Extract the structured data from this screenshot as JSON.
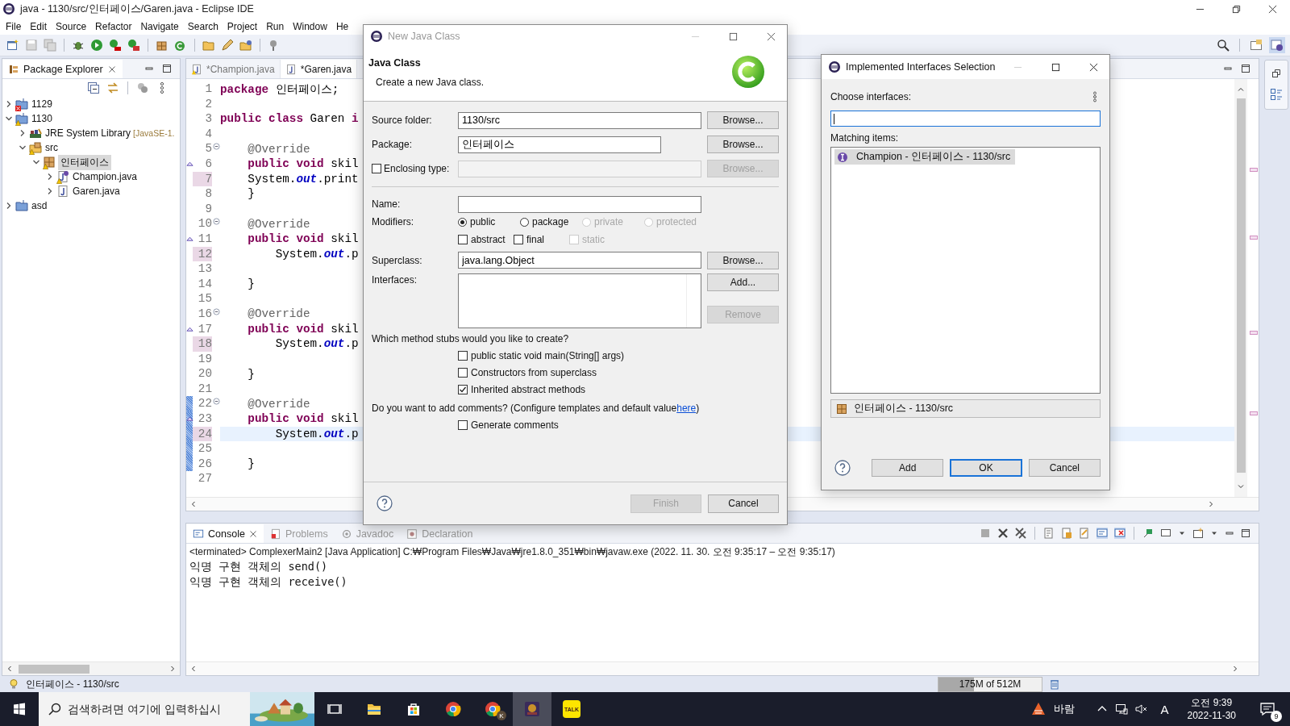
{
  "window": {
    "title": "java - 1130/src/인터페이스/Garen.java - Eclipse IDE"
  },
  "menu": [
    "File",
    "Edit",
    "Source",
    "Refactor",
    "Navigate",
    "Search",
    "Project",
    "Run",
    "Window",
    "He"
  ],
  "package_explorer": {
    "title": "Package Explorer",
    "tree": [
      {
        "label": "1129",
        "kind": "project",
        "error": true,
        "warning": false,
        "expanded": false,
        "selected": false
      },
      {
        "label": "1130",
        "kind": "project",
        "error": false,
        "warning": true,
        "expanded": true,
        "selected": false,
        "children": [
          {
            "label": "JRE System Library",
            "decoration": "[JavaSE-1.",
            "kind": "library",
            "error": false,
            "warning": false,
            "expanded": false,
            "selected": false
          },
          {
            "label": "src",
            "kind": "srcfolder",
            "error": false,
            "warning": true,
            "expanded": true,
            "selected": false,
            "children": [
              {
                "label": "인터페이스",
                "kind": "package",
                "error": false,
                "warning": true,
                "expanded": true,
                "selected": true,
                "children": [
                  {
                    "label": "Champion.java",
                    "kind": "interface",
                    "error": false,
                    "warning": true,
                    "expanded": false,
                    "selected": false
                  },
                  {
                    "label": "Garen.java",
                    "kind": "class",
                    "error": false,
                    "warning": false,
                    "expanded": false,
                    "selected": false
                  }
                ]
              }
            ]
          }
        ]
      },
      {
        "label": "asd",
        "kind": "project",
        "error": false,
        "warning": false,
        "expanded": false,
        "selected": false
      }
    ]
  },
  "editor": {
    "tabs": [
      {
        "label": "*Champion.java",
        "kind": "interface",
        "selected": false
      },
      {
        "label": "*Garen.java",
        "kind": "class",
        "selected": true
      }
    ],
    "lines": [
      {
        "n": "1",
        "fold": false,
        "override": false,
        "occurrence": false,
        "changed": false,
        "current": false,
        "tokens": [
          {
            "kind": "kw",
            "text": "package"
          },
          {
            "kind": "plain",
            "text": " 인터페이스;"
          }
        ]
      },
      {
        "n": "2",
        "fold": false,
        "override": false,
        "occurrence": false,
        "changed": false,
        "current": false
      },
      {
        "n": "3",
        "fold": false,
        "override": false,
        "occurrence": false,
        "changed": false,
        "current": false,
        "tokens": [
          {
            "kind": "kw",
            "text": "public"
          },
          {
            "kind": "kw",
            "text": " class"
          },
          {
            "kind": "plain",
            "text": " Garen "
          },
          {
            "kind": "kw",
            "text": "i"
          }
        ]
      },
      {
        "n": "4",
        "fold": false,
        "override": false,
        "occurrence": false,
        "changed": false,
        "current": false
      },
      {
        "n": "5",
        "fold": true,
        "override": false,
        "occurrence": false,
        "changed": false,
        "current": false,
        "tokens": [
          {
            "kind": "ann",
            "text": "    @Override"
          }
        ]
      },
      {
        "n": "6",
        "fold": false,
        "override": true,
        "occurrence": false,
        "changed": false,
        "current": false,
        "tokens": [
          {
            "kind": "kw",
            "text": "    public"
          },
          {
            "kind": "kw",
            "text": " void"
          },
          {
            "kind": "plain",
            "text": " skil"
          }
        ]
      },
      {
        "n": "7",
        "fold": false,
        "override": false,
        "occurrence": true,
        "changed": false,
        "current": false,
        "tokens": [
          {
            "kind": "plain",
            "text": "    System."
          },
          {
            "kind": "field",
            "text": "out"
          },
          {
            "kind": "plain",
            "text": ".print"
          }
        ]
      },
      {
        "n": "8",
        "fold": false,
        "override": false,
        "occurrence": false,
        "changed": false,
        "current": false,
        "tokens": [
          {
            "kind": "plain",
            "text": "    }"
          }
        ]
      },
      {
        "n": "9",
        "fold": false,
        "override": false,
        "occurrence": false,
        "changed": false,
        "current": false
      },
      {
        "n": "10",
        "fold": true,
        "override": false,
        "occurrence": false,
        "changed": false,
        "current": false,
        "tokens": [
          {
            "kind": "ann",
            "text": "    @Override"
          }
        ]
      },
      {
        "n": "11",
        "fold": false,
        "override": true,
        "occurrence": false,
        "changed": false,
        "current": false,
        "tokens": [
          {
            "kind": "kw",
            "text": "    public"
          },
          {
            "kind": "kw",
            "text": " void"
          },
          {
            "kind": "plain",
            "text": " skil"
          }
        ]
      },
      {
        "n": "12",
        "fold": false,
        "override": false,
        "occurrence": true,
        "changed": false,
        "current": false,
        "tokens": [
          {
            "kind": "plain",
            "text": "        System."
          },
          {
            "kind": "field",
            "text": "out"
          },
          {
            "kind": "plain",
            "text": ".p"
          }
        ]
      },
      {
        "n": "13",
        "fold": false,
        "override": false,
        "occurrence": false,
        "changed": false,
        "current": false
      },
      {
        "n": "14",
        "fold": false,
        "override": false,
        "occurrence": false,
        "changed": false,
        "current": false,
        "tokens": [
          {
            "kind": "plain",
            "text": "    }"
          }
        ]
      },
      {
        "n": "15",
        "fold": false,
        "override": false,
        "occurrence": false,
        "changed": false,
        "current": false
      },
      {
        "n": "16",
        "fold": true,
        "override": false,
        "occurrence": false,
        "changed": false,
        "current": false,
        "tokens": [
          {
            "kind": "ann",
            "text": "    @Override"
          }
        ]
      },
      {
        "n": "17",
        "fold": false,
        "override": true,
        "occurrence": false,
        "changed": false,
        "current": false,
        "tokens": [
          {
            "kind": "kw",
            "text": "    public"
          },
          {
            "kind": "kw",
            "text": " void"
          },
          {
            "kind": "plain",
            "text": " skil"
          }
        ]
      },
      {
        "n": "18",
        "fold": false,
        "override": false,
        "occurrence": true,
        "changed": false,
        "current": false,
        "tokens": [
          {
            "kind": "plain",
            "text": "        System."
          },
          {
            "kind": "field",
            "text": "out"
          },
          {
            "kind": "plain",
            "text": ".p"
          }
        ]
      },
      {
        "n": "19",
        "fold": false,
        "override": false,
        "occurrence": false,
        "changed": false,
        "current": false
      },
      {
        "n": "20",
        "fold": false,
        "override": false,
        "occurrence": false,
        "changed": false,
        "current": false,
        "tokens": [
          {
            "kind": "plain",
            "text": "    }"
          }
        ]
      },
      {
        "n": "21",
        "fold": false,
        "override": false,
        "occurrence": false,
        "changed": false,
        "current": false
      },
      {
        "n": "22",
        "fold": true,
        "override": false,
        "occurrence": false,
        "changed": true,
        "current": false,
        "tokens": [
          {
            "kind": "ann",
            "text": "    @Override"
          }
        ]
      },
      {
        "n": "23",
        "fold": false,
        "override": true,
        "occurrence": false,
        "changed": true,
        "current": false,
        "tokens": [
          {
            "kind": "kw",
            "text": "    public"
          },
          {
            "kind": "kw",
            "text": " void"
          },
          {
            "kind": "plain",
            "text": " skil"
          }
        ]
      },
      {
        "n": "24",
        "fold": false,
        "override": false,
        "occurrence": true,
        "changed": true,
        "current": true,
        "tokens": [
          {
            "kind": "plain",
            "text": "        System."
          },
          {
            "kind": "field",
            "text": "out"
          },
          {
            "kind": "plain",
            "text": ".p"
          }
        ]
      },
      {
        "n": "25",
        "fold": false,
        "override": false,
        "occurrence": false,
        "changed": true,
        "current": false
      },
      {
        "n": "26",
        "fold": false,
        "override": false,
        "occurrence": false,
        "changed": true,
        "current": false,
        "tokens": [
          {
            "kind": "plain",
            "text": "    }"
          }
        ]
      },
      {
        "n": "27",
        "fold": false,
        "override": false,
        "occurrence": false,
        "changed": false,
        "current": false
      }
    ]
  },
  "console": {
    "tabs": [
      {
        "label": "Console",
        "kind": "console",
        "selected": true
      },
      {
        "label": "Problems",
        "kind": "problems",
        "selected": false
      },
      {
        "label": "Javadoc",
        "kind": "javadoc",
        "selected": false
      },
      {
        "label": "Declaration",
        "kind": "declaration",
        "selected": false
      }
    ],
    "process": "<terminated> ComplexerMain2 [Java Application] C:₩Program Files₩Java₩jre1.8.0_351₩bin₩javaw.exe  (2022. 11. 30. 오전 9:35:17 – 오전 9:35:17)",
    "output": [
      "익명 구현 객체의 send()",
      "익명 구현 객체의 receive()"
    ]
  },
  "status_bar": {
    "message": "인터페이스 - 1130/src",
    "heap": {
      "text": "175M of 512M",
      "level": 0.34
    }
  },
  "new_class_dialog": {
    "title": "New Java Class",
    "active": false,
    "heading": "Java Class",
    "description": "Create a new Java class.",
    "source_folder": {
      "label": "Source folder:",
      "value": "1130/src",
      "browse": {
        "label": "Browse...",
        "disabled": false
      }
    },
    "package": {
      "label": "Package:",
      "value": "인터페이스",
      "browse": {
        "label": "Browse...",
        "disabled": false
      }
    },
    "enclosing_type": {
      "label": "Enclosing type:",
      "checked": false,
      "browse": {
        "label": "Browse...",
        "disabled": true
      }
    },
    "name": {
      "label": "Name:"
    },
    "modifiers": {
      "label": "Modifiers:",
      "access": [
        {
          "label": "public",
          "selected": true,
          "disabled": false
        },
        {
          "label": "package",
          "selected": false,
          "disabled": false
        },
        {
          "label": "private",
          "selected": false,
          "disabled": true
        },
        {
          "label": "protected",
          "selected": false,
          "disabled": true
        }
      ],
      "flags": [
        {
          "label": "abstract",
          "checked": false,
          "disabled": false
        },
        {
          "label": "final",
          "checked": false,
          "disabled": false
        },
        {
          "label": "static",
          "checked": false,
          "disabled": true
        }
      ]
    },
    "superclass": {
      "label": "Superclass:",
      "value": "java.lang.Object",
      "browse": {
        "label": "Browse...",
        "disabled": false
      }
    },
    "interfaces": {
      "label": "Interfaces:",
      "add": {
        "label": "Add...",
        "disabled": false
      },
      "remove": {
        "label": "Remove",
        "disabled": true
      }
    },
    "stubs": {
      "question": "Which method stubs would you like to create?",
      "options": [
        {
          "label": "public static void main(String[] args)",
          "checked": false
        },
        {
          "label": "Constructors from superclass",
          "checked": false
        },
        {
          "label": "Inherited abstract methods",
          "checked": true
        }
      ]
    },
    "comments": {
      "before": "Do you want to add comments? (Configure templates and default value ",
      "link": "here",
      "after": ")",
      "options": [
        {
          "label": "Generate comments",
          "checked": false
        }
      ]
    },
    "buttons": [
      {
        "label": "Finish",
        "disabled": true
      },
      {
        "label": "Cancel",
        "disabled": false
      }
    ]
  },
  "interfaces_dialog": {
    "title": "Implemented Interfaces Selection",
    "active": true,
    "filter_label": "Choose interfaces:",
    "matches_label": "Matching items:",
    "items": [
      {
        "label": "Champion - 인터페이스 - 1130/src",
        "selected": true
      }
    ],
    "location": "인터페이스 - 1130/src",
    "buttons": [
      {
        "label": "Add",
        "default": false
      },
      {
        "label": "OK",
        "default": true
      },
      {
        "label": "Cancel",
        "default": false
      }
    ]
  },
  "taskbar": {
    "search_placeholder": "검색하려면 여기에 입력하십시",
    "apps": [
      {
        "kind": "taskview",
        "active": false
      },
      {
        "kind": "folder",
        "active": false
      },
      {
        "kind": "store",
        "active": false
      },
      {
        "kind": "browser",
        "active": false
      },
      {
        "kind": "browser",
        "badge": "K",
        "active": false
      },
      {
        "kind": "game",
        "active": true
      },
      {
        "kind": "chat",
        "label": "TALK",
        "active": false
      }
    ],
    "weather": "바람",
    "ime": "A",
    "time": "오전 9:39",
    "date": "2022-11-30",
    "notifications": "9"
  }
}
